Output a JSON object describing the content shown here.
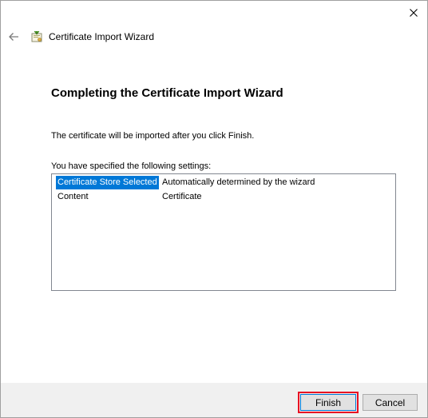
{
  "window": {
    "title": "Certificate Import Wizard"
  },
  "page": {
    "heading": "Completing the Certificate Import Wizard",
    "info_text": "The certificate will be imported after you click Finish.",
    "settings_label": "You have specified the following settings:"
  },
  "settings": [
    {
      "name": "Certificate Store Selected",
      "value": "Automatically determined by the wizard",
      "selected": true
    },
    {
      "name": "Content",
      "value": "Certificate",
      "selected": false
    }
  ],
  "buttons": {
    "finish": "Finish",
    "cancel": "Cancel"
  },
  "colors": {
    "selection": "#0078d7",
    "footer_bg": "#f0f0f0",
    "highlight_outline": "#e81123"
  },
  "icons": {
    "close": "close-icon",
    "back": "back-arrow-icon",
    "wizard": "certificate-wizard-icon"
  }
}
